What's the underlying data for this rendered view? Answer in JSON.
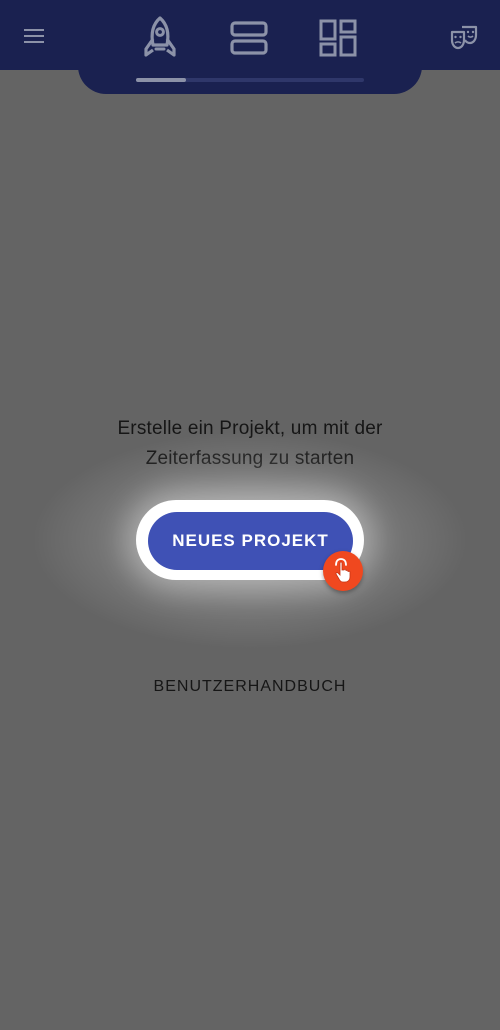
{
  "app_bar": {
    "tabs": [
      {
        "name": "rocket",
        "icon": "rocket-icon",
        "active": true
      },
      {
        "name": "list",
        "icon": "view-list-icon",
        "active": false
      },
      {
        "name": "dashboard",
        "icon": "dashboard-icon",
        "active": false
      }
    ],
    "menu_icon": "menu-icon",
    "mode_icon": "theater-masks-icon"
  },
  "empty_state": {
    "message_line1": "Erstelle ein Projekt, um mit der",
    "message_line2": "Zeiterfassung zu starten",
    "new_project_label": "NEUES PROJEKT",
    "manual_label": "BENUTZERHANDBUCH"
  },
  "colors": {
    "app_bar": "#1a2150",
    "scrim": "#646464",
    "primary_button": "#3f51b5",
    "tap_hint": "#f0481f"
  }
}
